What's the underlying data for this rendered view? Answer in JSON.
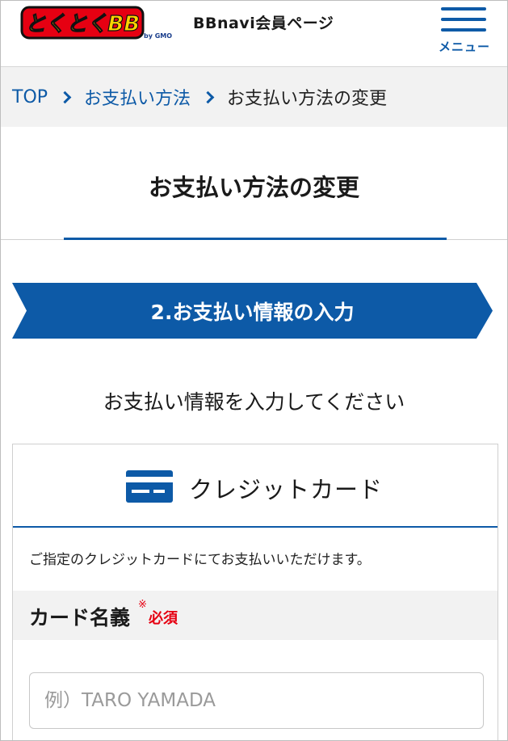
{
  "header": {
    "logo_text": "とくとくBB",
    "logo_by": "by GMO",
    "site_title": "BBnavi会員ページ",
    "menu_label": "メニュー"
  },
  "breadcrumb": {
    "items": [
      "TOP",
      "お支払い方法"
    ],
    "current": "お支払い方法の変更"
  },
  "page": {
    "title": "お支払い方法の変更"
  },
  "step": {
    "label": "2.お支払い情報の入力"
  },
  "instruction": "お支払い情報を入力してください",
  "credit_card": {
    "title": "クレジットカード",
    "note": "ご指定のクレジットカードにてお支払いいただけます。",
    "field_label": "カード名義",
    "required_mark": "※",
    "required_text": "必須",
    "input_placeholder": "例）TARO YAMADA",
    "input_value": ""
  },
  "colors": {
    "brand_blue": "#0d5aa7",
    "required_red": "#e60012",
    "logo_red": "#e60012",
    "logo_yellow": "#ffd400"
  }
}
